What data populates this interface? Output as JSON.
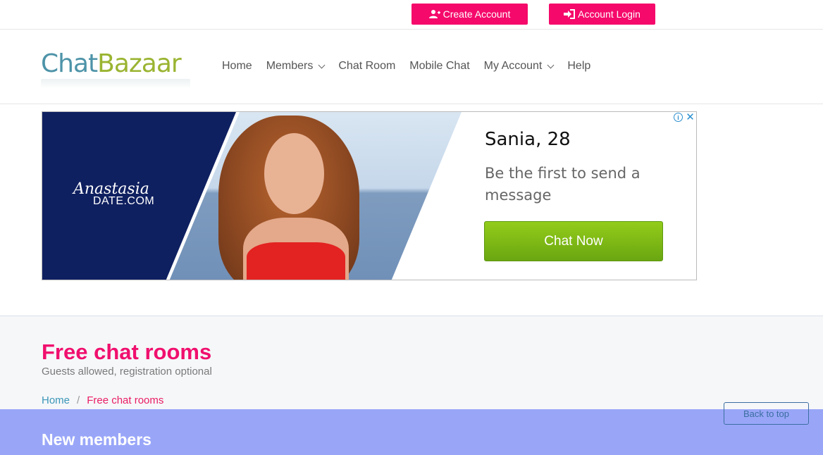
{
  "topbar": {
    "create_label": "Create Account",
    "login_label": "Account Login"
  },
  "logo": {
    "part1": "Chat",
    "part2": "Bazaar"
  },
  "nav": {
    "items": [
      {
        "label": "Home"
      },
      {
        "label": "Members"
      },
      {
        "label": "Chat Room"
      },
      {
        "label": "Mobile Chat"
      },
      {
        "label": "My Account"
      },
      {
        "label": "Help"
      }
    ]
  },
  "ad": {
    "brand_script": "Anastasia",
    "brand_domain": "DATE.COM",
    "name_age": "Sania, 28",
    "message": "Be the first to send a message",
    "cta": "Chat Now",
    "info_icon": "i",
    "close_icon": "✕",
    "colors": {
      "navy": "#0f2060",
      "cta": "#7cb815"
    }
  },
  "intro": {
    "title": "Free chat rooms",
    "subtitle": "Guests allowed, registration optional",
    "breadcrumb": {
      "home": "Home",
      "sep": "/",
      "current": "Free chat rooms"
    }
  },
  "members": {
    "title": "New members"
  },
  "back_to_top": "Back to top",
  "colors": {
    "accent": "#f5096b",
    "band": "#99a6f8",
    "link": "#3a96b8"
  }
}
